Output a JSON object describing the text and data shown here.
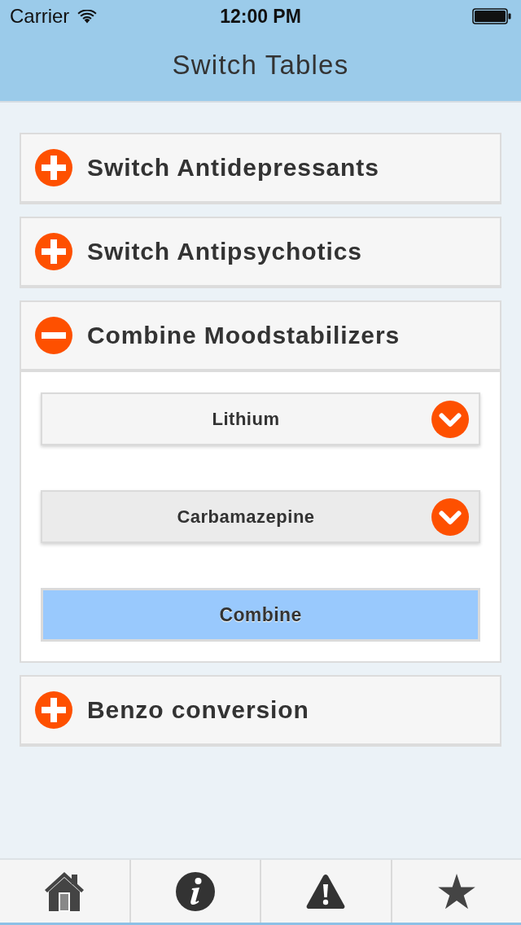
{
  "status_bar": {
    "carrier": "Carrier",
    "time": "12:00 PM"
  },
  "nav_bar": {
    "title": "Switch Tables"
  },
  "sections": [
    {
      "title": "Switch Antidepressants",
      "expanded": false
    },
    {
      "title": "Switch Antipsychotics",
      "expanded": false
    },
    {
      "title": "Combine Moodstabilizers",
      "expanded": true,
      "selects": [
        {
          "value": "Lithium",
          "highlighted": false
        },
        {
          "value": "Carbamazepine",
          "highlighted": true
        }
      ],
      "button": "Combine"
    },
    {
      "title": "Benzo conversion",
      "expanded": false
    }
  ],
  "tab_bar": {
    "tabs": [
      {
        "kind": "home"
      },
      {
        "kind": "info"
      },
      {
        "kind": "warning"
      },
      {
        "kind": "star"
      }
    ]
  }
}
